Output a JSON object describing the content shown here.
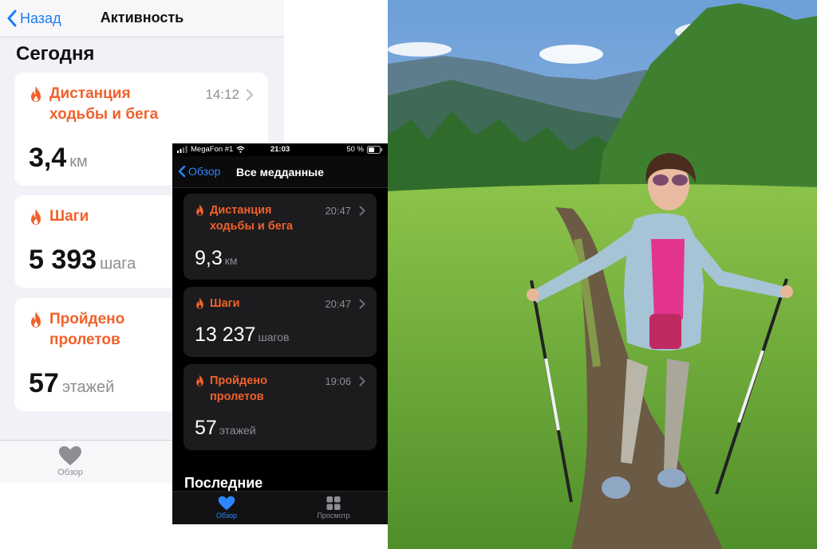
{
  "light_screen": {
    "nav": {
      "back_label": "Назад",
      "title": "Активность"
    },
    "section_title": "Сегодня",
    "cards": [
      {
        "label_line1": "Дистанция",
        "label_line2": "ходьбы и бега",
        "time": "14:12",
        "value": "3,4",
        "unit": "км"
      },
      {
        "label_line1": "Шаги",
        "value": "5 393",
        "unit": "шага"
      },
      {
        "label_line1": "Пройдено",
        "label_line2": "пролетов",
        "value": "57",
        "unit": "этажей"
      }
    ],
    "tabbar": {
      "summary_label": "Обзор"
    }
  },
  "dark_screen": {
    "status": {
      "carrier": "MegaFon #1",
      "time": "21:03",
      "battery": "50 %"
    },
    "nav": {
      "back_label": "Обзор",
      "title": "Все медданные"
    },
    "cards": [
      {
        "label_line1": "Дистанция",
        "label_line2": "ходьбы и бега",
        "time": "20:47",
        "value": "9,3",
        "unit": "км"
      },
      {
        "label_line1": "Шаги",
        "time": "20:47",
        "value": "13 237",
        "unit": "шагов"
      },
      {
        "label_line1": "Пройдено",
        "label_line2": "пролетов",
        "time": "19:06",
        "value": "57",
        "unit": "этажей"
      }
    ],
    "section_title": "Последние",
    "tabbar": {
      "summary_label": "Обзор",
      "browse_label": "Просмотр"
    }
  },
  "colors": {
    "accent_orange": "#f0612a",
    "ios_blue": "#1a7cf5",
    "dark_bg": "#000000",
    "dark_card": "#1c1c1e",
    "light_bg": "#f2f1f7"
  },
  "icons": [
    "chevron-left-icon",
    "chevron-right-icon",
    "flame-icon",
    "heart-icon",
    "grid-icon",
    "signal-icon",
    "wifi-icon",
    "battery-icon"
  ]
}
